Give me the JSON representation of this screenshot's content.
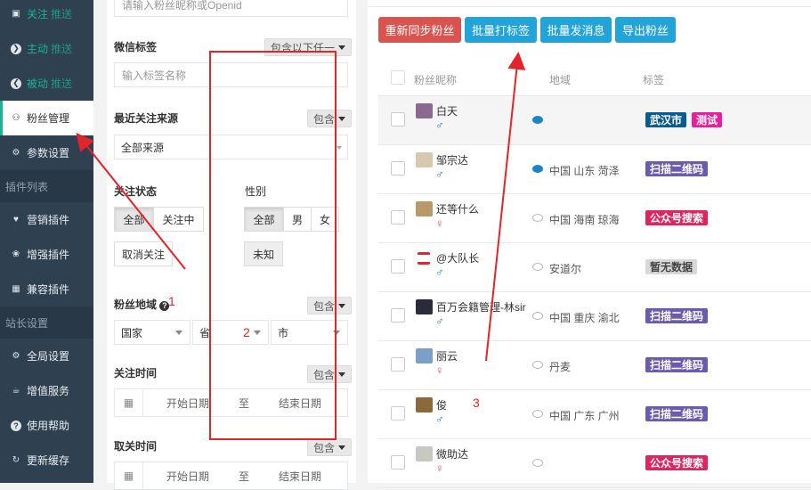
{
  "sidebar": {
    "items": [
      {
        "label": "关注",
        "label2": "推送",
        "icon": "rss-icon",
        "glyph": "▣",
        "green": true
      },
      {
        "label": "主动",
        "label2": "推送",
        "icon": "arrow-circle-right-icon",
        "glyph": "❯",
        "green": true,
        "circle": true
      },
      {
        "label": "被动",
        "label2": "推送",
        "icon": "arrow-circle-left-icon",
        "glyph": "❮",
        "green": true,
        "circle": true
      },
      {
        "label": "粉丝管理",
        "icon": "users-icon",
        "glyph": "⚇",
        "active": true
      },
      {
        "label": "参数设置",
        "icon": "gear-icon",
        "glyph": "⚙"
      }
    ],
    "section1": "插件列表",
    "plugins": [
      {
        "label": "营销插件",
        "icon": "heart-icon",
        "glyph": "♥"
      },
      {
        "label": "增强插件",
        "icon": "paw-icon",
        "glyph": "❀"
      },
      {
        "label": "兼容插件",
        "icon": "grid-icon",
        "glyph": "▦"
      }
    ],
    "section2": "站长设置",
    "settings": [
      {
        "label": "全局设置",
        "icon": "gear-icon",
        "glyph": "⚙"
      },
      {
        "label": "增值服务",
        "icon": "coffee-icon",
        "glyph": "☕"
      },
      {
        "label": "使用帮助",
        "icon": "question-circle-icon",
        "glyph": "?",
        "circle": true
      },
      {
        "label": "更新缓存",
        "icon": "refresh-icon",
        "glyph": "↻"
      }
    ]
  },
  "filters": {
    "top_placeholder": "请输入粉丝昵称或Openid",
    "tag_label": "微信标签",
    "tag_mode": "包含以下任一",
    "tag_placeholder": "输入标签名称",
    "source_label": "最近关注来源",
    "source_mode": "包含",
    "source_value": "全部来源",
    "follow_label": "关注状态",
    "follow_options": [
      "全部",
      "关注中"
    ],
    "follow_cancel": "取消关注",
    "gender_label": "性别",
    "gender_options": [
      "全部",
      "男",
      "女"
    ],
    "gender_unknown": "未知",
    "region_label": "粉丝地域",
    "region_help": "?",
    "region_mode": "包含",
    "country": "国家",
    "province": "省",
    "city": "市",
    "follow_time_label": "关注时间",
    "follow_time_mode": "包含",
    "date_start": "开始日期",
    "date_to": "至",
    "date_end": "结束日期",
    "unfollow_time_label": "取关时间",
    "unfollow_time_mode": "包含",
    "date_start2": "开始日期",
    "date_to2": "至",
    "date_end2": "结束日期"
  },
  "actions": {
    "resync": "重新同步粉丝",
    "batch_tag": "批量打标签",
    "batch_msg": "批量发消息",
    "export": "导出粉丝"
  },
  "colors": {
    "danger": "#d9534f",
    "info": "#23a4d9",
    "sidebar_bg": "#2f4050",
    "accent_green": "#1ab394",
    "annotation_red": "#e2242b"
  },
  "table": {
    "headers": [
      "粉丝昵称",
      "地域",
      "标签"
    ],
    "rows": [
      {
        "nick": "白天",
        "sex": "♂",
        "sex_class": "m",
        "chat": "on",
        "region": "",
        "tags": [
          {
            "text": "武汉市",
            "color": "#0a5c8c"
          },
          {
            "text": "测试",
            "color": "#e91e9c"
          }
        ],
        "avatar": "#8b6a8f"
      },
      {
        "nick": "邹宗达",
        "sex": "♂",
        "sex_class": "m",
        "chat": "on",
        "region": "中国  山东  菏泽",
        "tags": [
          {
            "text": "扫描二维码",
            "color": "#6a5bac"
          }
        ],
        "avatar": "#d8c8b0"
      },
      {
        "nick": "还等什么",
        "sex": "♀",
        "sex_class": "f",
        "chat": "off",
        "region": "中国  海南  琼海",
        "tags": [
          {
            "text": "公众号搜索",
            "color": "#e0245e"
          }
        ],
        "avatar": "#b89a6a"
      },
      {
        "nick": "@大队长",
        "sex": "♂",
        "sex_class": "m",
        "chat": "off",
        "region": "安道尔",
        "tags": [
          {
            "text": "暂无数据",
            "color": "#d8d8d8",
            "dark": true
          }
        ],
        "avatar": "#e2242b"
      },
      {
        "nick": "百万会籍管理-林sir",
        "sex": "♂",
        "sex_class": "m",
        "chat": "off",
        "region": "中国  重庆  渝北",
        "tags": [
          {
            "text": "扫描二维码",
            "color": "#6a5bac"
          }
        ],
        "avatar": "#2a2a3a"
      },
      {
        "nick": "丽云",
        "sex": "♀",
        "sex_class": "f",
        "chat": "off",
        "region": "丹麦",
        "tags": [
          {
            "text": "扫描二维码",
            "color": "#6a5bac"
          }
        ],
        "avatar": "#7aa0c8"
      },
      {
        "nick": "俊",
        "sex": "♂",
        "sex_class": "m",
        "chat": "off",
        "region": "中国  广东  广州",
        "tags": [
          {
            "text": "扫描二维码",
            "color": "#6a5bac"
          }
        ],
        "avatar": "#8a6a3a"
      },
      {
        "nick": "微助达",
        "sex": "♀",
        "sex_class": "f",
        "chat": "off",
        "region": "",
        "tags": [
          {
            "text": "公众号搜索",
            "color": "#e0245e"
          }
        ],
        "avatar": "#c8c8c0"
      }
    ]
  },
  "annotations": {
    "n1": "1",
    "n2": "2",
    "n3": "3"
  }
}
